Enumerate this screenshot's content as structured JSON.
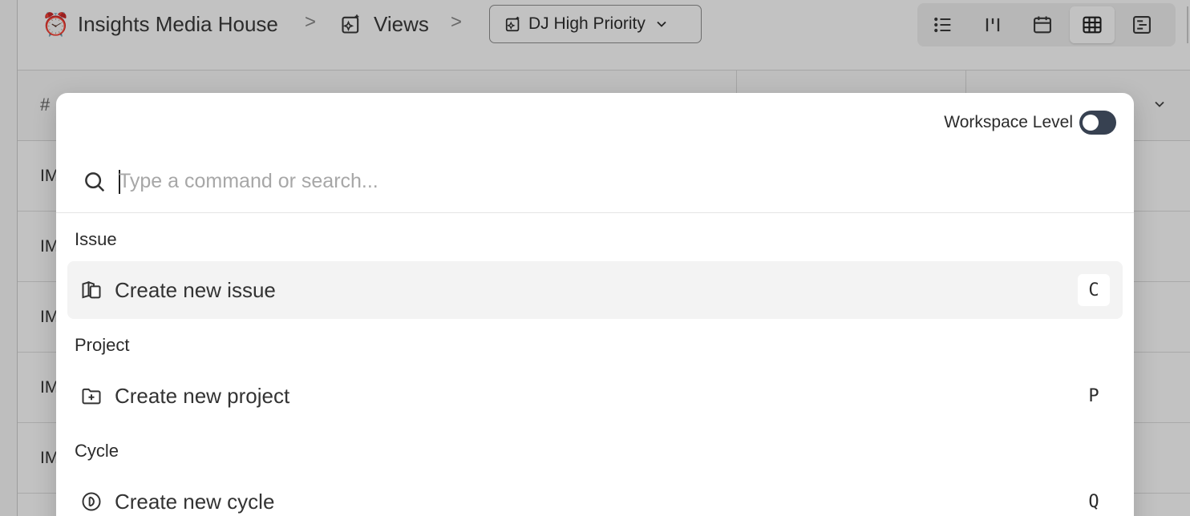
{
  "header": {
    "workspace_emoji": "⏰",
    "workspace_name": "Insights Media House",
    "breadcrumb_separator": ">",
    "views_label": "Views",
    "current_view": "DJ High Priority",
    "layouts": [
      {
        "icon": "list-layout-icon",
        "active": false
      },
      {
        "icon": "kanban-layout-icon",
        "active": false
      },
      {
        "icon": "calendar-layout-icon",
        "active": false
      },
      {
        "icon": "spreadsheet-layout-icon",
        "active": true
      },
      {
        "icon": "gantt-layout-icon",
        "active": false
      }
    ]
  },
  "table": {
    "header_hash": "#",
    "rows": [
      "IM",
      "IM",
      "IM",
      "IM",
      "IM"
    ]
  },
  "command_palette": {
    "workspace_level_label": "Workspace Level",
    "workspace_level_enabled": false,
    "search": {
      "placeholder": "Type a command or search...",
      "value": ""
    },
    "groups": [
      {
        "title": "Issue",
        "command": {
          "label": "Create new issue",
          "shortcut": "C",
          "icon": "issues-stack-icon",
          "selected": true
        }
      },
      {
        "title": "Project",
        "command": {
          "label": "Create new project",
          "shortcut": "P",
          "icon": "folder-plus-icon",
          "selected": false
        }
      },
      {
        "title": "Cycle",
        "command": {
          "label": "Create new cycle",
          "shortcut": "Q",
          "icon": "cycle-icon",
          "selected": false
        }
      }
    ]
  },
  "colors": {
    "overlay": "rgba(0,0,0,0.24)",
    "toggle_off": "#374151",
    "selected_row": "#f3f3f3",
    "placeholder": "#a7a7a7"
  }
}
